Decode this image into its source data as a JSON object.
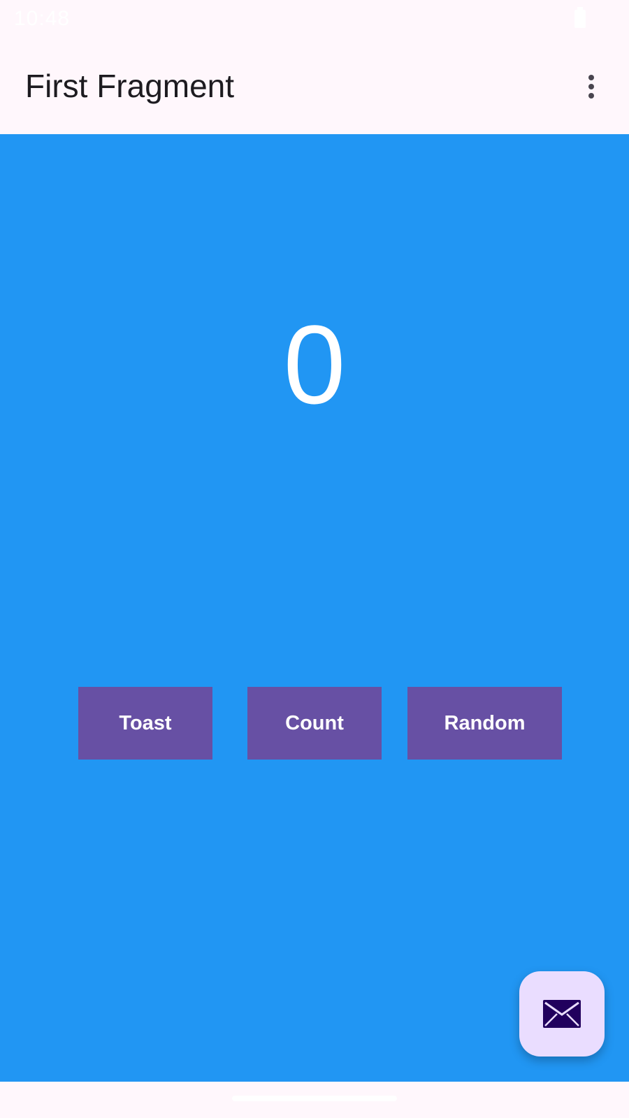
{
  "status_bar": {
    "time": "10:48"
  },
  "app_bar": {
    "title": "First Fragment",
    "menu_icon": "more-vert-icon"
  },
  "main": {
    "counter": "0",
    "background_color": "#2196F3",
    "buttons": [
      {
        "label": "Toast"
      },
      {
        "label": "Count"
      },
      {
        "label": "Random"
      }
    ],
    "button_color": "#6750A4"
  },
  "fab": {
    "icon": "email-icon",
    "background_color": "#EADDFF"
  }
}
